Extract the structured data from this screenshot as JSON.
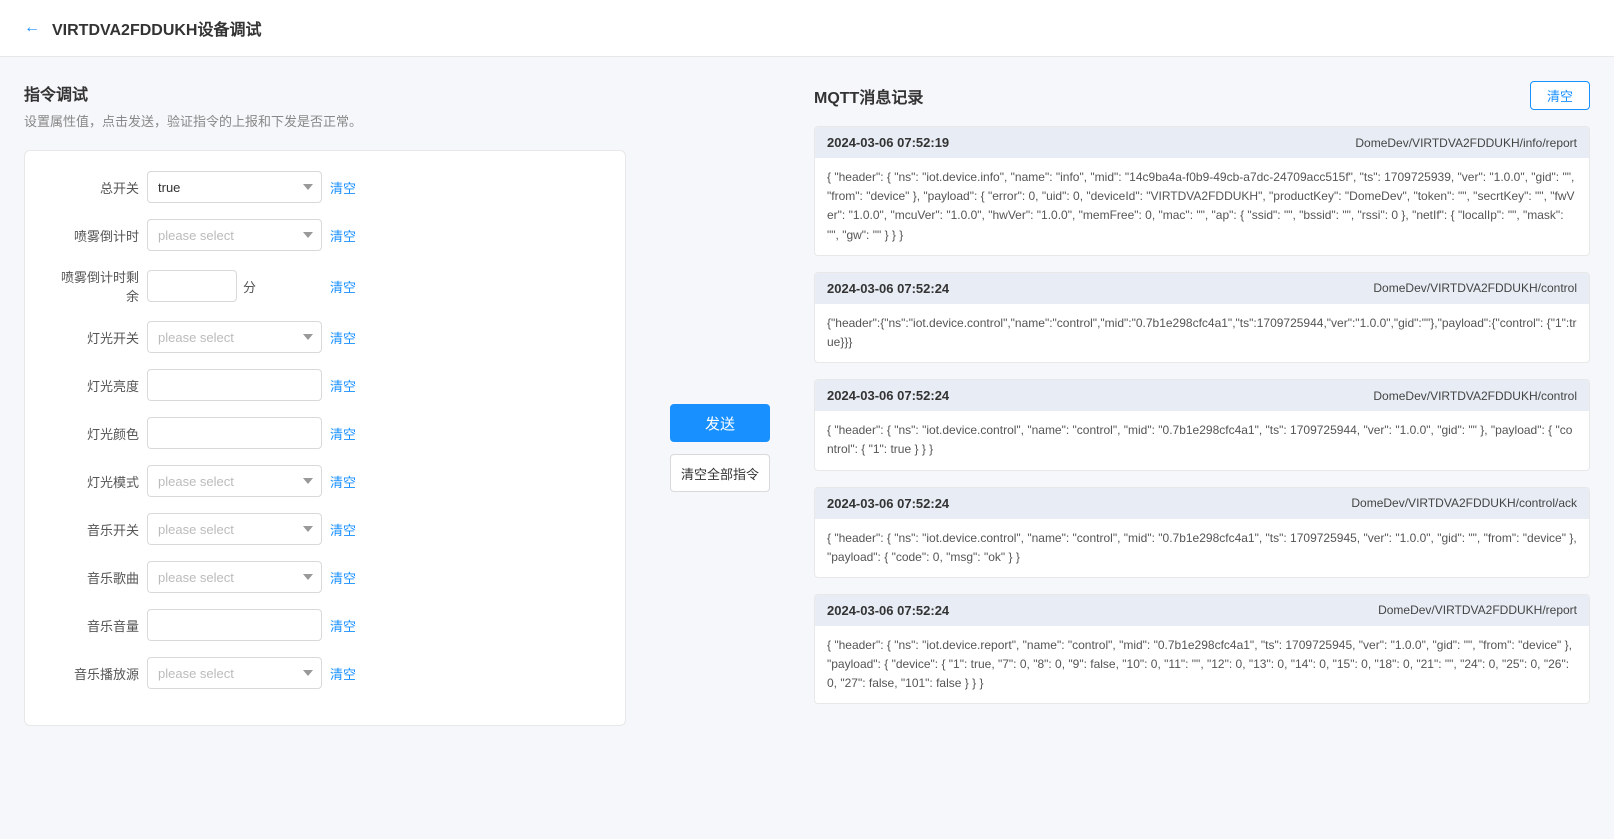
{
  "header": {
    "back_label": "←",
    "title": "VIRTDVA2FDDUKH设备调试"
  },
  "left": {
    "section_title": "指令调试",
    "section_desc": "设置属性值，点击发送，验证指令的上报和下发是否正常。",
    "fields": [
      {
        "id": "total_switch",
        "label": "总开关",
        "type": "select",
        "value": "true",
        "placeholder": "please select",
        "unit": null
      },
      {
        "id": "spray_countdown",
        "label": "喷雾倒计时",
        "type": "select",
        "value": "",
        "placeholder": "please select",
        "unit": null
      },
      {
        "id": "spray_remain",
        "label": "喷雾倒计时剩余",
        "type": "text",
        "value": "",
        "placeholder": "",
        "unit": "分"
      },
      {
        "id": "light_switch",
        "label": "灯光开关",
        "type": "select",
        "value": "",
        "placeholder": "please select",
        "unit": null
      },
      {
        "id": "light_brightness",
        "label": "灯光亮度",
        "type": "text",
        "value": "",
        "placeholder": "",
        "unit": null
      },
      {
        "id": "light_color",
        "label": "灯光颜色",
        "type": "text",
        "value": "",
        "placeholder": "",
        "unit": null
      },
      {
        "id": "light_mode",
        "label": "灯光模式",
        "type": "select",
        "value": "",
        "placeholder": "please select",
        "unit": null
      },
      {
        "id": "music_switch",
        "label": "音乐开关",
        "type": "select",
        "value": "",
        "placeholder": "please select",
        "unit": null
      },
      {
        "id": "music_song",
        "label": "音乐歌曲",
        "type": "select",
        "value": "",
        "placeholder": "please select",
        "unit": null
      },
      {
        "id": "music_volume",
        "label": "音乐音量",
        "type": "text",
        "value": "",
        "placeholder": "",
        "unit": null
      },
      {
        "id": "music_source",
        "label": "音乐播放源",
        "type": "select",
        "value": "",
        "placeholder": "please select",
        "unit": null
      }
    ],
    "clear_label": "清空"
  },
  "buttons": {
    "send_label": "发送",
    "clear_all_label": "清空全部指令"
  },
  "right": {
    "title": "MQTT消息记录",
    "clear_log_label": "清空",
    "logs": [
      {
        "time": "2024-03-06 07:52:19",
        "topic": "DomeDev/VIRTDVA2FDDUKH/info/report",
        "body": "{ \"header\": { \"ns\": \"iot.device.info\", \"name\": \"info\", \"mid\": \"14c9ba4a-f0b9-49cb-a7dc-24709acc515f\", \"ts\": 1709725939, \"ver\": \"1.0.0\", \"gid\": \"\", \"from\": \"device\" }, \"payload\": { \"error\": 0, \"uid\": 0, \"deviceId\": \"VIRTDVA2FDDUKH\", \"productKey\": \"DomeDev\", \"token\": \"\", \"secrtKey\": \"\", \"fwVer\": \"1.0.0\", \"mcuVer\": \"1.0.0\", \"hwVer\": \"1.0.0\", \"memFree\": 0, \"mac\": \"\", \"ap\": { \"ssid\": \"\", \"bssid\": \"\", \"rssi\": 0 }, \"netIf\": { \"localIp\": \"\", \"mask\": \"\", \"gw\": \"\" } } }"
      },
      {
        "time": "2024-03-06 07:52:24",
        "topic": "DomeDev/VIRTDVA2FDDUKH/control",
        "body": "{\"header\":{\"ns\":\"iot.device.control\",\"name\":\"control\",\"mid\":\"0.7b1e298cfc4a1\",\"ts\":1709725944,\"ver\":\"1.0.0\",\"gid\":\"\"},\"payload\":{\"control\": {\"1\":true}}}"
      },
      {
        "time": "2024-03-06 07:52:24",
        "topic": "DomeDev/VIRTDVA2FDDUKH/control",
        "body": "{ \"header\": { \"ns\": \"iot.device.control\", \"name\": \"control\", \"mid\": \"0.7b1e298cfc4a1\", \"ts\": 1709725944, \"ver\": \"1.0.0\", \"gid\": \"\" }, \"payload\": { \"control\": { \"1\": true } } }"
      },
      {
        "time": "2024-03-06 07:52:24",
        "topic": "DomeDev/VIRTDVA2FDDUKH/control/ack",
        "body": "{ \"header\": { \"ns\": \"iot.device.control\", \"name\": \"control\", \"mid\": \"0.7b1e298cfc4a1\", \"ts\": 1709725945, \"ver\": \"1.0.0\", \"gid\": \"\", \"from\": \"device\" }, \"payload\": { \"code\": 0, \"msg\": \"ok\" } }"
      },
      {
        "time": "2024-03-06 07:52:24",
        "topic": "DomeDev/VIRTDVA2FDDUKH/report",
        "body": "{ \"header\": { \"ns\": \"iot.device.report\", \"name\": \"control\", \"mid\": \"0.7b1e298cfc4a1\", \"ts\": 1709725945, \"ver\": \"1.0.0\", \"gid\": \"\", \"from\": \"device\" }, \"payload\": { \"device\": { \"1\": true, \"7\": 0, \"8\": 0, \"9\": false, \"10\": 0, \"11\": \"\", \"12\": 0, \"13\": 0, \"14\": 0, \"15\": 0, \"18\": 0, \"21\": \"\", \"24\": 0, \"25\": 0, \"26\": 0, \"27\": false, \"101\": false } } }"
      }
    ]
  }
}
